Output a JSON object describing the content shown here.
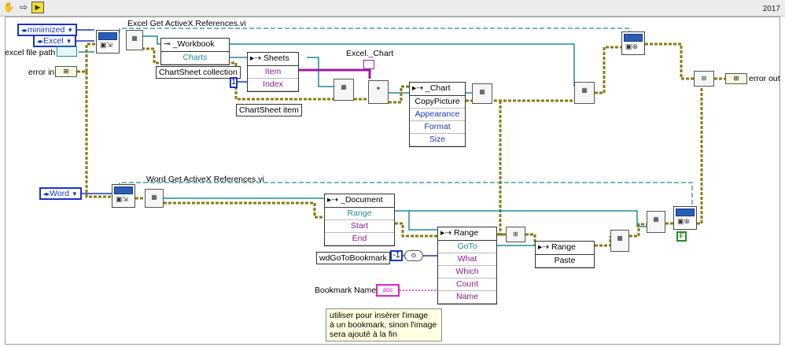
{
  "window": {
    "version_label": "2017"
  },
  "controls": {
    "window_state": "minimized",
    "excel_app": "Excel",
    "excel_file_path": "excel file path",
    "error_in": "error in",
    "word_app": "Word",
    "wd_goto_bookmark": "wdGoToBookmark",
    "goto_value": "-1",
    "bookmark_name": "Bookmark Name",
    "item_index": "1",
    "string_pill": "abc",
    "error_out": "error out"
  },
  "subvis": {
    "excel_get_refs": "Excel Get ActiveX References.vi",
    "word_get_refs": "Word Get ActiveX References.vi",
    "excel_chart_label": "Excel._Chart"
  },
  "nodes": {
    "workbook": {
      "title": "_Workbook",
      "rows": [
        "Charts"
      ]
    },
    "chartsheet_collection": "ChartSheet collection",
    "sheets": {
      "title": "Sheets",
      "rows": [
        "Item",
        "Index"
      ]
    },
    "chartsheet_item": "ChartSheet item",
    "chart": {
      "title": "_Chart",
      "rows": [
        "CopyPicture",
        "Appearance",
        "Format",
        "Size"
      ]
    },
    "document": {
      "title": "_Document",
      "rows": [
        "Range",
        "Start",
        "End"
      ]
    },
    "range1": {
      "title": "Range",
      "rows": [
        "GoTo",
        "What",
        "Which",
        "Count",
        "Name"
      ]
    },
    "range2": {
      "title": "Range",
      "rows": [
        "Paste"
      ]
    }
  },
  "comment": "utiliser pour insérer l'image\nà un bookmark, sinon l'image\nsera ajouté à la fin",
  "constants": {
    "false_const": "F"
  },
  "icons": {
    "hand": "hand-icon",
    "arrow": "arrow-icon",
    "run": "run-arrow-icon"
  }
}
